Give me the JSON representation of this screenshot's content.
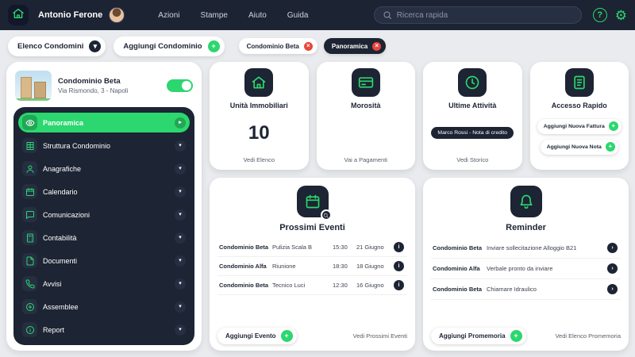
{
  "colors": {
    "accent": "#2bd76e",
    "dark": "#1d2433",
    "danger": "#e8463c",
    "background": "#e9ebee"
  },
  "header": {
    "user_name": "Antonio Ferone",
    "nav": [
      "Azioni",
      "Stampe",
      "Aiuto",
      "Guida"
    ],
    "search_placeholder": "Ricerca rapida",
    "help_label": "?"
  },
  "toolbar": {
    "elenco_label": "Elenco Condomini",
    "aggiungi_label": "Aggiungi Condominio",
    "tabs": [
      {
        "label": "Condominio Beta"
      },
      {
        "label": "Panoramica"
      }
    ]
  },
  "condo_card": {
    "name": "Condominio Beta",
    "address": "Via Rismondo, 3 - Napoli",
    "toggle_on": true
  },
  "sidebar": {
    "items": [
      {
        "label": "Panoramica",
        "icon": "eye-icon",
        "active": true
      },
      {
        "label": "Struttura Condominio",
        "icon": "structure-icon"
      },
      {
        "label": "Anagrafiche",
        "icon": "person-icon"
      },
      {
        "label": "Calendario",
        "icon": "calendar-icon"
      },
      {
        "label": "Comunicazioni",
        "icon": "chat-icon"
      },
      {
        "label": "Contabilità",
        "icon": "calculator-icon"
      },
      {
        "label": "Documenti",
        "icon": "document-icon"
      },
      {
        "label": "Avvisi",
        "icon": "phone-icon"
      },
      {
        "label": "Assemblee",
        "icon": "plus-circle-icon"
      },
      {
        "label": "Report",
        "icon": "info-icon"
      }
    ]
  },
  "cards": {
    "unita": {
      "title": "Unità Immobiliari",
      "value": "10",
      "link": "Vedi Elenco"
    },
    "morosita": {
      "title": "Morosità",
      "link": "Vai a Pagamenti"
    },
    "attivita": {
      "title": "Ultime Attività",
      "item": "Marco Rossi - Nota di credito",
      "link": "Vedi Storico"
    },
    "accesso": {
      "title": "Accesso Rapido",
      "buttons": [
        "Aggiungi Nuova Fattura",
        "Aggiungi Nuova Nota"
      ]
    }
  },
  "events": {
    "title": "Prossimi Eventi",
    "rows": [
      {
        "condo": "Condominio Beta",
        "name": "Pulizia Scala B",
        "time": "15:30",
        "date": "21 Giugno"
      },
      {
        "condo": "Condominio Alfa",
        "name": "Riunione",
        "time": "18:30",
        "date": "18 Giugno"
      },
      {
        "condo": "Condominio Beta",
        "name": "Tecnico Luci",
        "time": "12:30",
        "date": "16 Giugno"
      }
    ],
    "add_label": "Aggiungi Evento",
    "link": "Vedi Prossimi Eventi"
  },
  "reminders": {
    "title": "Reminder",
    "rows": [
      {
        "condo": "Condominio Beta",
        "text": "Inviare sollecitazione Alloggio B21"
      },
      {
        "condo": "Condominio Alfa",
        "text": "Verbale pronto da inviare"
      },
      {
        "condo": "Condominio Beta",
        "text": "Chiamare Idraulico"
      }
    ],
    "add_label": "Aggiungi Promemoria",
    "link": "Vedi Elenco Promemoria"
  }
}
